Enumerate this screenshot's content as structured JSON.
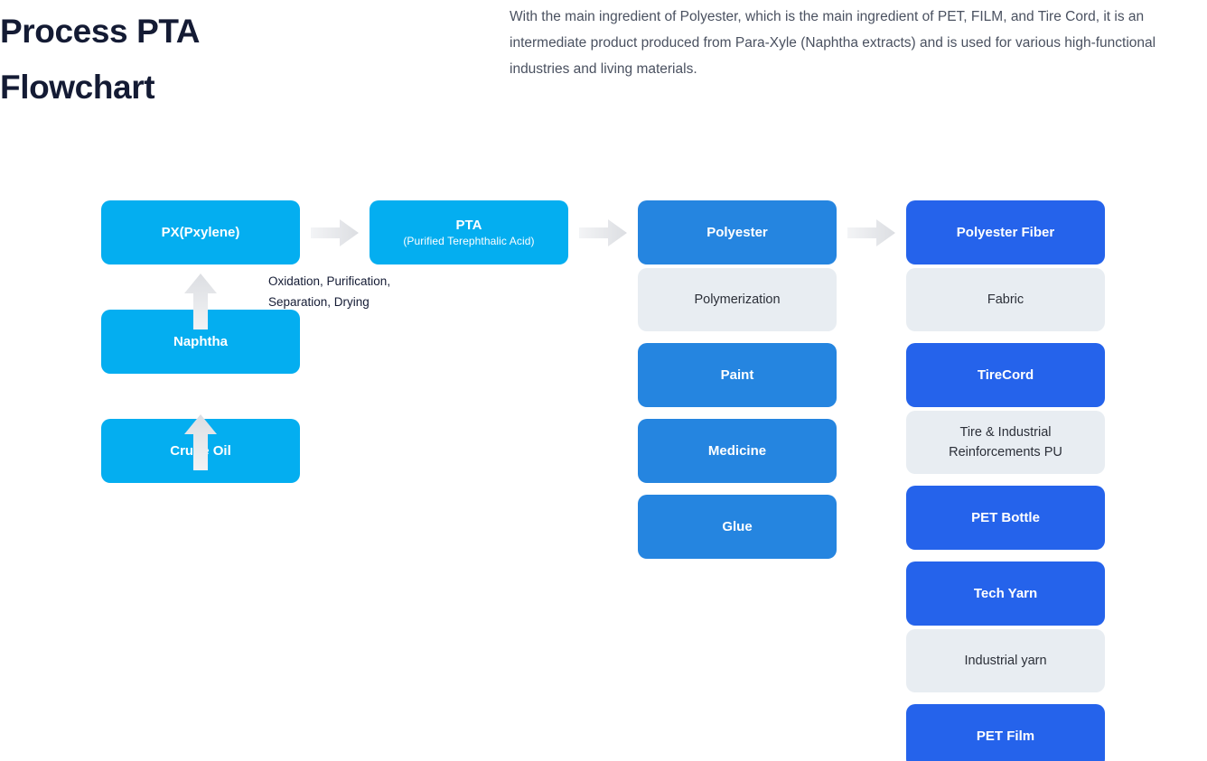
{
  "header": {
    "title": "Process PTA\nFlowchart",
    "title_color": "#141B34",
    "intro": "With the main ingredient of Polyester, which is the main ingredient of PET, FILM, and Tire Cord, it is an intermediate product produced from Para-Xyle (Naphtha extracts) and is used for various high-functional industries and living materials."
  },
  "colors": {
    "cyan": "#04AEF0",
    "blue": "#2585E0",
    "navy": "#2563EB",
    "gray_box": "#E8EDF2",
    "arrow": "#E3E5E8"
  },
  "flow": {
    "column1": {
      "px": {
        "label": "PX(Pxylene)"
      },
      "naphtha": {
        "label": "Naphtha"
      },
      "crude_oil": {
        "label": "Crude Oil"
      }
    },
    "column2": {
      "pta": {
        "label": "PTA",
        "sublabel": "(Purified Terephthalic Acid)"
      },
      "process_note": "Oxidation, Purification,\nSeparation, Drying"
    },
    "column3": {
      "polyester": {
        "label": "Polyester"
      },
      "polymerization": {
        "label": "Polymerization"
      },
      "paint": {
        "label": "Paint"
      },
      "medicine": {
        "label": "Medicine"
      },
      "glue": {
        "label": "Glue"
      }
    },
    "column4": {
      "polyester_fiber": {
        "label": "Polyester Fiber"
      },
      "fabric": {
        "label": "Fabric"
      },
      "tirecord": {
        "label": "TireCord"
      },
      "tire_note": {
        "label": "Tire & Industrial\nReinforcements PU"
      },
      "pet_bottle": {
        "label": "PET Bottle"
      },
      "tech_yarn": {
        "label": "Tech Yarn"
      },
      "industrial_yarn": {
        "label": "Industrial yarn"
      },
      "pet_film": {
        "label": "PET Film"
      }
    }
  }
}
